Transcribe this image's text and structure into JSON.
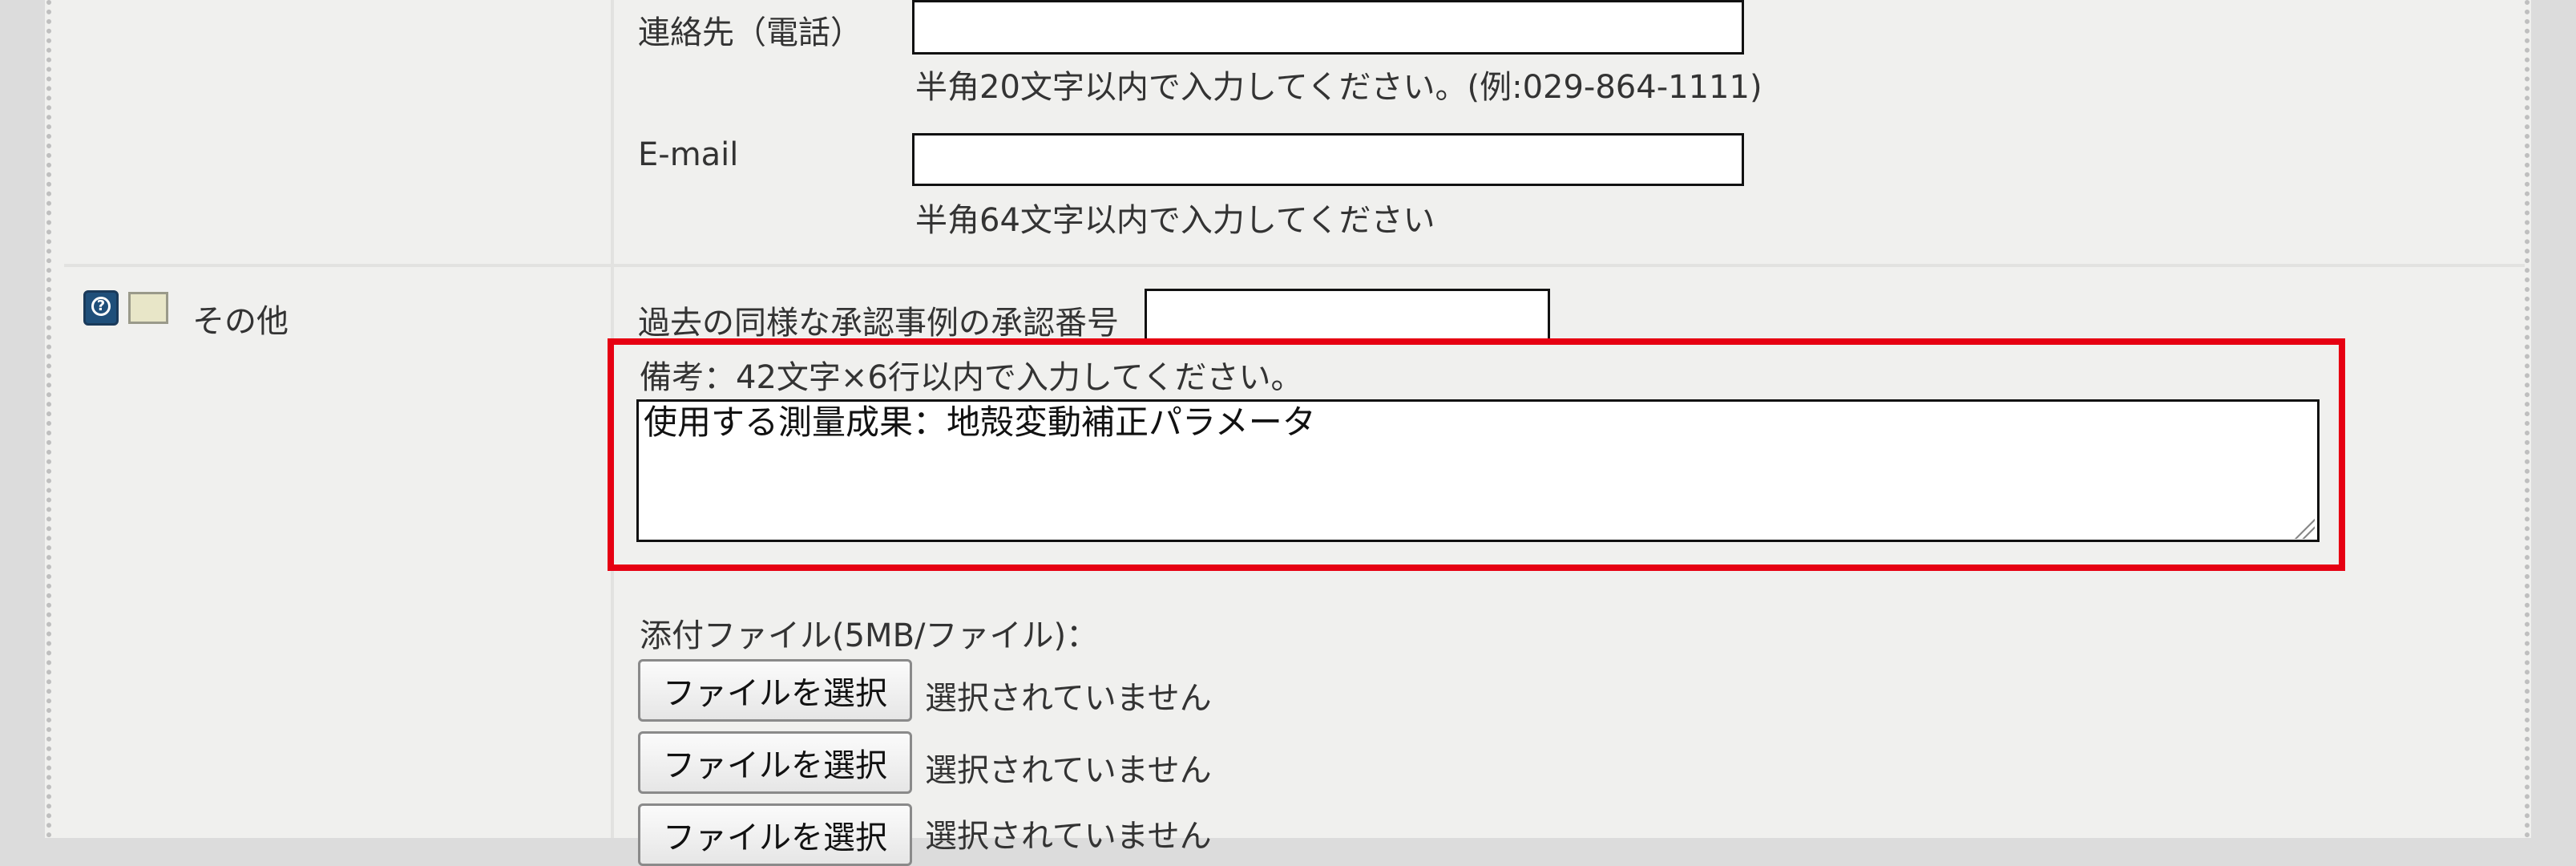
{
  "contact": {
    "phone_label": "連絡先（電話）",
    "phone_value": "",
    "phone_hint": "半角20文字以内で入力してください。(例:029-864-1111)",
    "email_label": "E-mail",
    "email_value": "",
    "email_hint": "半角64文字以内で入力してください"
  },
  "other": {
    "section_label": "その他",
    "help_icon": "help-icon",
    "memo_icon": "memo-icon",
    "past_approval_label": "過去の同様な承認事例の承認番号",
    "past_approval_value": "",
    "remarks_hint": "備考：42文字×6行以内で入力してください。",
    "remarks_value": "使用する測量成果：地殻変動補正パラメータ",
    "attachments_label": "添付ファイル(5MB/ファイル)：",
    "files": [
      {
        "button_label": "ファイルを選択",
        "status": "選択されていません"
      },
      {
        "button_label": "ファイルを選択",
        "status": "選択されていません"
      },
      {
        "button_label": "ファイルを選択",
        "status": "選択されていません"
      }
    ]
  },
  "colors": {
    "highlight": "#e60012",
    "background": "#f0f0ee"
  }
}
